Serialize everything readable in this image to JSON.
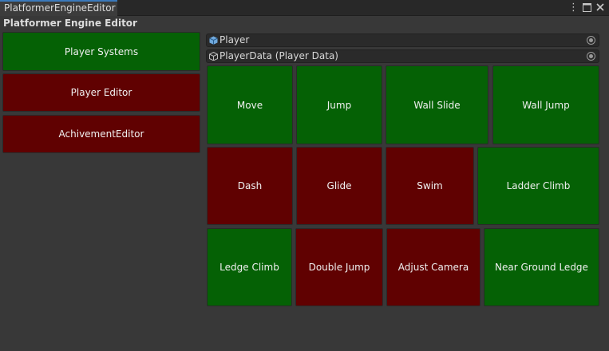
{
  "window": {
    "tab_label": "PlatformerEngineEditor",
    "title": "Platformer Engine Editor",
    "menu_icon": "kebab-menu-icon",
    "maximize_icon": "maximize-icon",
    "close_icon": "close-icon"
  },
  "sidebar": {
    "items": [
      {
        "label": "Player Systems",
        "state": "enabled"
      },
      {
        "label": "Player Editor",
        "state": "disabled"
      },
      {
        "label": "AchivementEditor",
        "state": "disabled"
      }
    ]
  },
  "fields": {
    "player": {
      "value": "Player",
      "icon": "gameobject-cube-icon"
    },
    "player_data": {
      "value": "PlayerData (Player Data)",
      "icon": "scriptable-object-icon"
    }
  },
  "systems": [
    {
      "label": "Move",
      "enabled": true
    },
    {
      "label": "Jump",
      "enabled": true
    },
    {
      "label": "Wall Slide",
      "enabled": true
    },
    {
      "label": "Wall Jump",
      "enabled": true
    },
    {
      "label": "Dash",
      "enabled": false
    },
    {
      "label": "Glide",
      "enabled": false
    },
    {
      "label": "Swim",
      "enabled": false
    },
    {
      "label": "Ladder Climb",
      "enabled": true
    },
    {
      "label": "Ledge Climb",
      "enabled": true
    },
    {
      "label": "Double Jump",
      "enabled": false
    },
    {
      "label": "Adjust Camera",
      "enabled": false
    },
    {
      "label": "Near Ground Ledge",
      "enabled": true
    }
  ],
  "colors": {
    "enabled": "#056105",
    "disabled": "#600101",
    "background": "#383838",
    "tab_accent": "#3a79bb"
  }
}
